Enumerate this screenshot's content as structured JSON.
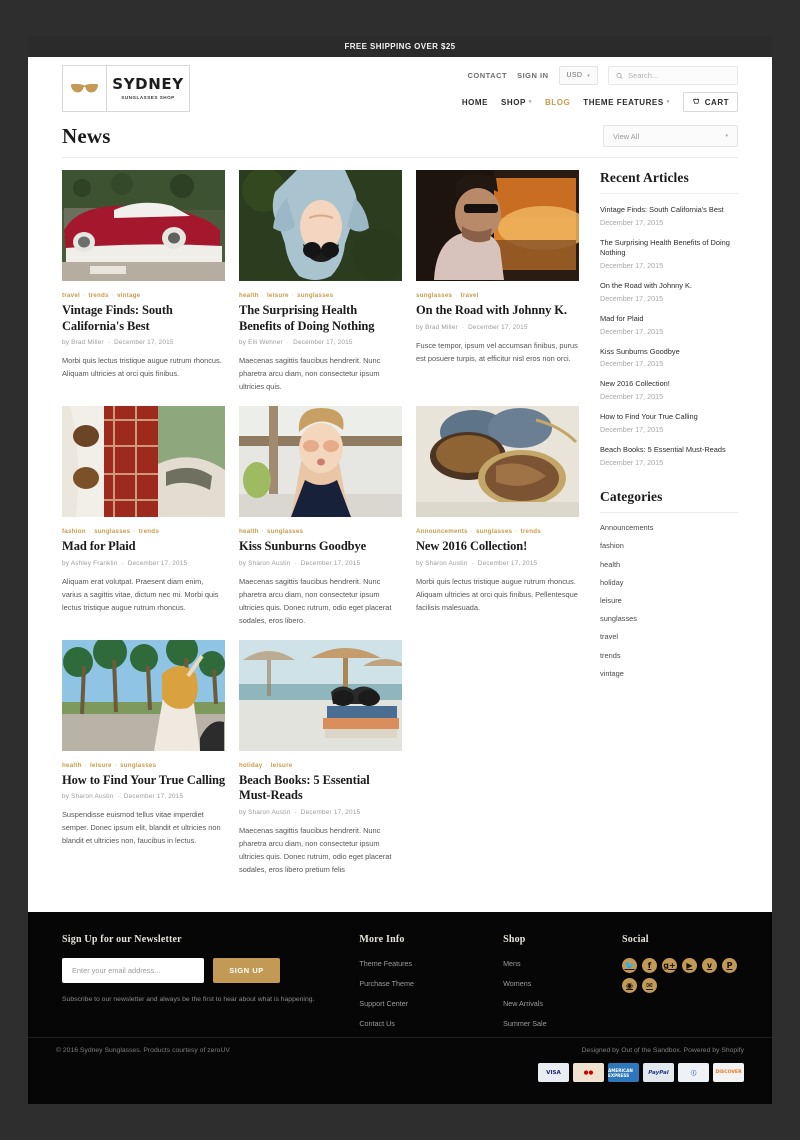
{
  "announcement": "FREE SHIPPING OVER $25",
  "brand": {
    "name": "SYDNEY",
    "tagline": "SUNGLASSES SHOP",
    "logo_icon": "sunglasses-icon"
  },
  "utility_nav": {
    "contact": "CONTACT",
    "sign_in": "SIGN IN",
    "currency": "USD",
    "search_placeholder": "Search...",
    "search_value": ""
  },
  "main_nav": [
    {
      "label": "HOME",
      "active": false,
      "has_caret": false
    },
    {
      "label": "SHOP",
      "active": false,
      "has_caret": true
    },
    {
      "label": "BLOG",
      "active": true,
      "has_caret": false
    },
    {
      "label": "THEME FEATURES",
      "active": false,
      "has_caret": true
    }
  ],
  "cart_label": "CART",
  "page": {
    "title": "News",
    "filter_selected": "View All"
  },
  "articles": [
    {
      "image_alt": "vintage-red-car",
      "tags": [
        "travel",
        "trends",
        "vintage"
      ],
      "title": "Vintage Finds: South California's Best",
      "author": "by Brad Miller",
      "date": "December 17, 2015",
      "excerpt": "Morbi quis lectus tristique augue rutrum rhoncus. Aliquam ultricies at orci quis finibus."
    },
    {
      "image_alt": "woman-lying-on-grass",
      "tags": [
        "health",
        "leisure",
        "sunglasses"
      ],
      "title": "The Surprising Health Benefits of Doing Nothing",
      "author": "by Elli Wehner",
      "date": "December 17, 2015",
      "excerpt": "Maecenas sagittis faucibus hendrerit. Nunc pharetra arcu diam, non consectetur ipsum ultricies quis."
    },
    {
      "image_alt": "man-in-car-at-sunset",
      "tags": [
        "sunglasses",
        "travel"
      ],
      "title": "On the Road with Johnny K.",
      "author": "by Brad Miller",
      "date": "December 17, 2015",
      "excerpt": "Fusce tempor, ipsum vel accumsan finibus, purus est posuere turpis, at efficitur nisl eros non orci."
    },
    {
      "image_alt": "plaid-shirt-and-sunglasses",
      "tags": [
        "fashion",
        "sunglasses",
        "trends"
      ],
      "title": "Mad for Plaid",
      "author": "by Ashley Franklin",
      "date": "December 17, 2015",
      "excerpt": "Aliquam erat volutpat. Praesent diam enim, varius a sagittis vitae, dictum nec mi. Morbi quis lectus tristique augue rutrum rhoncus."
    },
    {
      "image_alt": "woman-at-beach-with-sunglasses",
      "tags": [
        "health",
        "sunglasses"
      ],
      "title": "Kiss Sunburns Goodbye",
      "author": "by Sharon Austin",
      "date": "December 17, 2015",
      "excerpt": "Maecenas sagittis faucibus hendrerit. Nunc pharetra arcu diam, non consectetur ipsum ultricies quis. Donec rutrum, odio eget placerat sodales, eros libero."
    },
    {
      "image_alt": "pile-of-sunglasses",
      "tags": [
        "Announcements",
        "sunglasses",
        "trends"
      ],
      "title": "New 2016 Collection!",
      "author": "by Sharon Austin",
      "date": "December 17, 2015",
      "excerpt": "Morbi quis lectus tristique augue rutrum rhoncus. Aliquam ultricies at orci quis finibus. Pellentesque facilisis malesuada."
    },
    {
      "image_alt": "woman-on-palm-lined-street",
      "tags": [
        "health",
        "leisure",
        "sunglasses"
      ],
      "title": "How to Find Your True Calling",
      "author": "by Sharon Austin",
      "date": "December 17, 2015",
      "excerpt": "Suspendisse euismod tellus vitae imperdiet semper. Donec ipsum elit, blandit et ultricies non blandit et ultricies non, faucibus in lectus."
    },
    {
      "image_alt": "books-and-sunglasses-on-beach",
      "tags": [
        "holiday",
        "leisure"
      ],
      "title": "Beach Books: 5 Essential Must-Reads",
      "author": "by Sharon Austin",
      "date": "December 17, 2015",
      "excerpt": "Maecenas sagittis faucibus hendrerit. Nunc pharetra arcu diam, non consectetur ipsum ultricies quis. Donec rutrum, odio eget placerat sodales, eros libero pretium felis"
    }
  ],
  "sidebar": {
    "recent_heading": "Recent Articles",
    "recent": [
      {
        "title": "Vintage Finds: South California's Best",
        "date": "December 17, 2015"
      },
      {
        "title": "The Surprising Health Benefits of Doing Nothing",
        "date": "December 17, 2015"
      },
      {
        "title": "On the Road with Johnny K.",
        "date": "December 17, 2015"
      },
      {
        "title": "Mad for Plaid",
        "date": "December 17, 2015"
      },
      {
        "title": "Kiss Sunburns Goodbye",
        "date": "December 17, 2015"
      },
      {
        "title": "New 2016 Collection!",
        "date": "December 17, 2015"
      },
      {
        "title": "How to Find Your True Calling",
        "date": "December 17, 2015"
      },
      {
        "title": "Beach Books: 5 Essential Must-Reads",
        "date": "December 17, 2015"
      }
    ],
    "categories_heading": "Categories",
    "categories": [
      "Announcements",
      "fashion",
      "health",
      "holiday",
      "leisure",
      "sunglasses",
      "travel",
      "trends",
      "vintage"
    ]
  },
  "footer": {
    "newsletter_heading": "Sign Up for our Newsletter",
    "email_placeholder": "Enter your email address...",
    "email_value": "",
    "signup_label": "SIGN UP",
    "newsletter_note": "Subscribe to our newsletter and always be the first to hear about what is happening.",
    "more_info_heading": "More Info",
    "more_info_links": [
      "Theme Features",
      "Purchase Theme",
      "Support Center",
      "Contact Us"
    ],
    "shop_heading": "Shop",
    "shop_links": [
      "Mens",
      "Womens",
      "New Arrivals",
      "Summer Sale"
    ],
    "social_heading": "Social",
    "social": [
      {
        "icon": "twitter-icon",
        "glyph": "🐦"
      },
      {
        "icon": "facebook-icon",
        "glyph": "f"
      },
      {
        "icon": "google-plus-icon",
        "glyph": "g+"
      },
      {
        "icon": "youtube-icon",
        "glyph": "▶"
      },
      {
        "icon": "vimeo-icon",
        "glyph": "v"
      },
      {
        "icon": "pinterest-icon",
        "glyph": "P"
      },
      {
        "icon": "instagram-icon",
        "glyph": "◉"
      },
      {
        "icon": "email-icon",
        "glyph": "✉"
      }
    ],
    "copyright": "© 2016 Sydney Sunglasses. Products courtesy of zeroUV",
    "credit": "Designed by Out of the Sandbox. Powered by Shopify",
    "payments": [
      {
        "name": "VISA",
        "label": "VISA",
        "cls": "pay-visa"
      },
      {
        "name": "mastercard",
        "label": "●●",
        "cls": "pay-mc"
      },
      {
        "name": "american-express",
        "label": "AMERICAN EXPRESS",
        "cls": "pay-amex"
      },
      {
        "name": "paypal",
        "label": "PayPal",
        "cls": "pay-pp"
      },
      {
        "name": "diners-club",
        "label": "ⓘ",
        "cls": "pay-dc"
      },
      {
        "name": "discover",
        "label": "DISCOVER",
        "cls": "pay-disc"
      }
    ]
  },
  "colors": {
    "accent": "#c29a55",
    "tag": "#c89b4a",
    "dark": "#060606",
    "announce_bg": "#2b2b2b"
  }
}
